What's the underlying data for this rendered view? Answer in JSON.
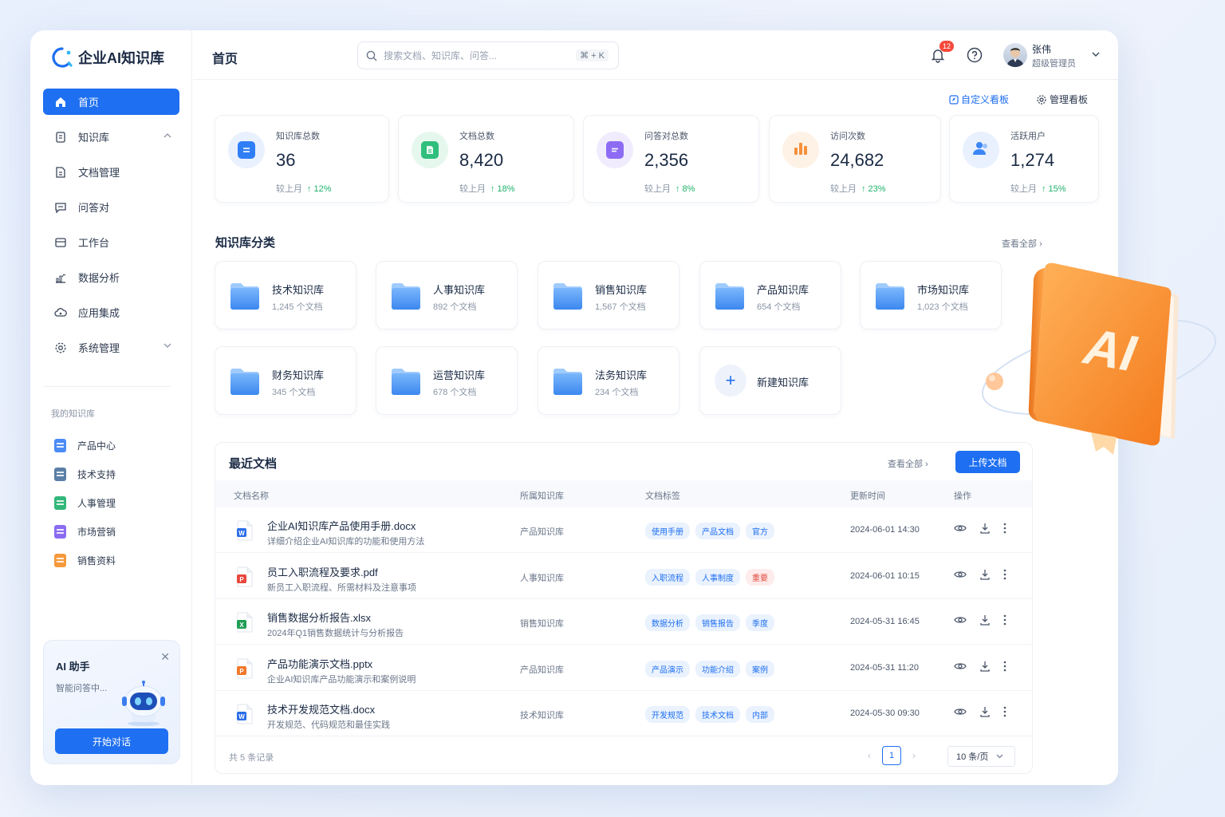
{
  "app": {
    "title": "企业AI知识库"
  },
  "nav": [
    {
      "label": "首页",
      "icon": "home-icon",
      "active": true
    },
    {
      "label": "知识库",
      "icon": "book-icon",
      "caret": "up"
    },
    {
      "label": "文档管理",
      "icon": "file-icon"
    },
    {
      "label": "问答对",
      "icon": "chat-icon"
    },
    {
      "label": "工作台",
      "icon": "desk-icon"
    },
    {
      "label": "数据分析",
      "icon": "chart-icon"
    },
    {
      "label": "应用集成",
      "icon": "cloud-icon"
    },
    {
      "label": "系统管理",
      "icon": "gear-icon",
      "caret": "down"
    }
  ],
  "my_kb": {
    "title": "我的知识库",
    "items": [
      {
        "label": "产品中心",
        "color": "#4b8cf5"
      },
      {
        "label": "技术支持",
        "color": "#5b7fa6"
      },
      {
        "label": "人事管理",
        "color": "#33b77a"
      },
      {
        "label": "市场营销",
        "color": "#8b6cf0"
      },
      {
        "label": "销售资料",
        "color": "#f59a3c"
      }
    ]
  },
  "assistant": {
    "title": "AI 助手",
    "subtitle": "智能问答中...",
    "button": "开始对话"
  },
  "header": {
    "page_title": "首页",
    "search_placeholder": "搜索文档、知识库、问答...",
    "shortcut": "⌘ + K",
    "notif_count": "12",
    "user_name": "张伟",
    "user_role": "超级管理员"
  },
  "toolbar": {
    "customize": "自定义看板",
    "manage": "管理看板"
  },
  "stats": [
    {
      "label": "知识库总数",
      "value": "36",
      "compare": "较上月",
      "delta": "↑ 12%",
      "color": "#2f7ef5",
      "bg": "#e9f1fe"
    },
    {
      "label": "文档总数",
      "value": "8,420",
      "compare": "较上月",
      "delta": "↑ 18%",
      "color": "#2fbf7c",
      "bg": "#e6f7ee"
    },
    {
      "label": "问答对总数",
      "value": "2,356",
      "compare": "较上月",
      "delta": "↑ 8%",
      "color": "#8d6cf3",
      "bg": "#f0ecfd"
    },
    {
      "label": "访问次数",
      "value": "24,682",
      "compare": "较上月",
      "delta": "↑ 23%",
      "color": "#f5913a",
      "bg": "#fef2e6"
    },
    {
      "label": "活跃用户",
      "value": "1,274",
      "compare": "较上月",
      "delta": "↑ 15%",
      "color": "#3b86f6",
      "bg": "#e9f1fe"
    }
  ],
  "kb_section": {
    "title": "知识库分类",
    "view_all": "查看全部"
  },
  "kb_cards": [
    {
      "name": "技术知识库",
      "count": "1,245 个文档"
    },
    {
      "name": "人事知识库",
      "count": "892 个文档"
    },
    {
      "name": "销售知识库",
      "count": "1,567 个文档"
    },
    {
      "name": "产品知识库",
      "count": "654 个文档"
    },
    {
      "name": "市场知识库",
      "count": "1,023 个文档"
    },
    {
      "name": "财务知识库",
      "count": "345 个文档"
    },
    {
      "name": "运营知识库",
      "count": "678 个文档"
    },
    {
      "name": "法务知识库",
      "count": "234 个文档"
    }
  ],
  "kb_new": "新建知识库",
  "recent": {
    "title": "最近文档",
    "view_all": "查看全部",
    "upload": "上传文档",
    "columns": [
      "文档名称",
      "所属知识库",
      "文档标签",
      "更新时间",
      "操作"
    ],
    "rows": [
      {
        "name": "企业AI知识库产品使用手册.docx",
        "desc": "详细介绍企业AI知识库的功能和使用方法",
        "kb": "产品知识库",
        "tags": [
          "使用手册",
          "产品文档",
          "官方"
        ],
        "time": "2024-06-01 14:30",
        "type": "word"
      },
      {
        "name": "员工入职流程及要求.pdf",
        "desc": "新员工入职流程、所需材料及注意事项",
        "kb": "人事知识库",
        "tags": [
          "入职流程",
          "人事制度",
          "重要"
        ],
        "time": "2024-06-01 10:15",
        "type": "pdf"
      },
      {
        "name": "销售数据分析报告.xlsx",
        "desc": "2024年Q1销售数据统计与分析报告",
        "kb": "销售知识库",
        "tags": [
          "数据分析",
          "销售报告",
          "季度"
        ],
        "time": "2024-05-31 16:45",
        "type": "excel"
      },
      {
        "name": "产品功能演示文档.pptx",
        "desc": "企业AI知识库产品功能演示和案例说明",
        "kb": "产品知识库",
        "tags": [
          "产品演示",
          "功能介绍",
          "案例"
        ],
        "time": "2024-05-31 11:20",
        "type": "ppt"
      },
      {
        "name": "技术开发规范文档.docx",
        "desc": "开发规范、代码规范和最佳实践",
        "kb": "技术知识库",
        "tags": [
          "开发规范",
          "技术文档",
          "内部"
        ],
        "time": "2024-05-30 09:30",
        "type": "word"
      }
    ],
    "total": "共 5 条记录",
    "page": "1",
    "per_page": "10 条/页"
  },
  "illustration": {
    "text": "AI"
  }
}
